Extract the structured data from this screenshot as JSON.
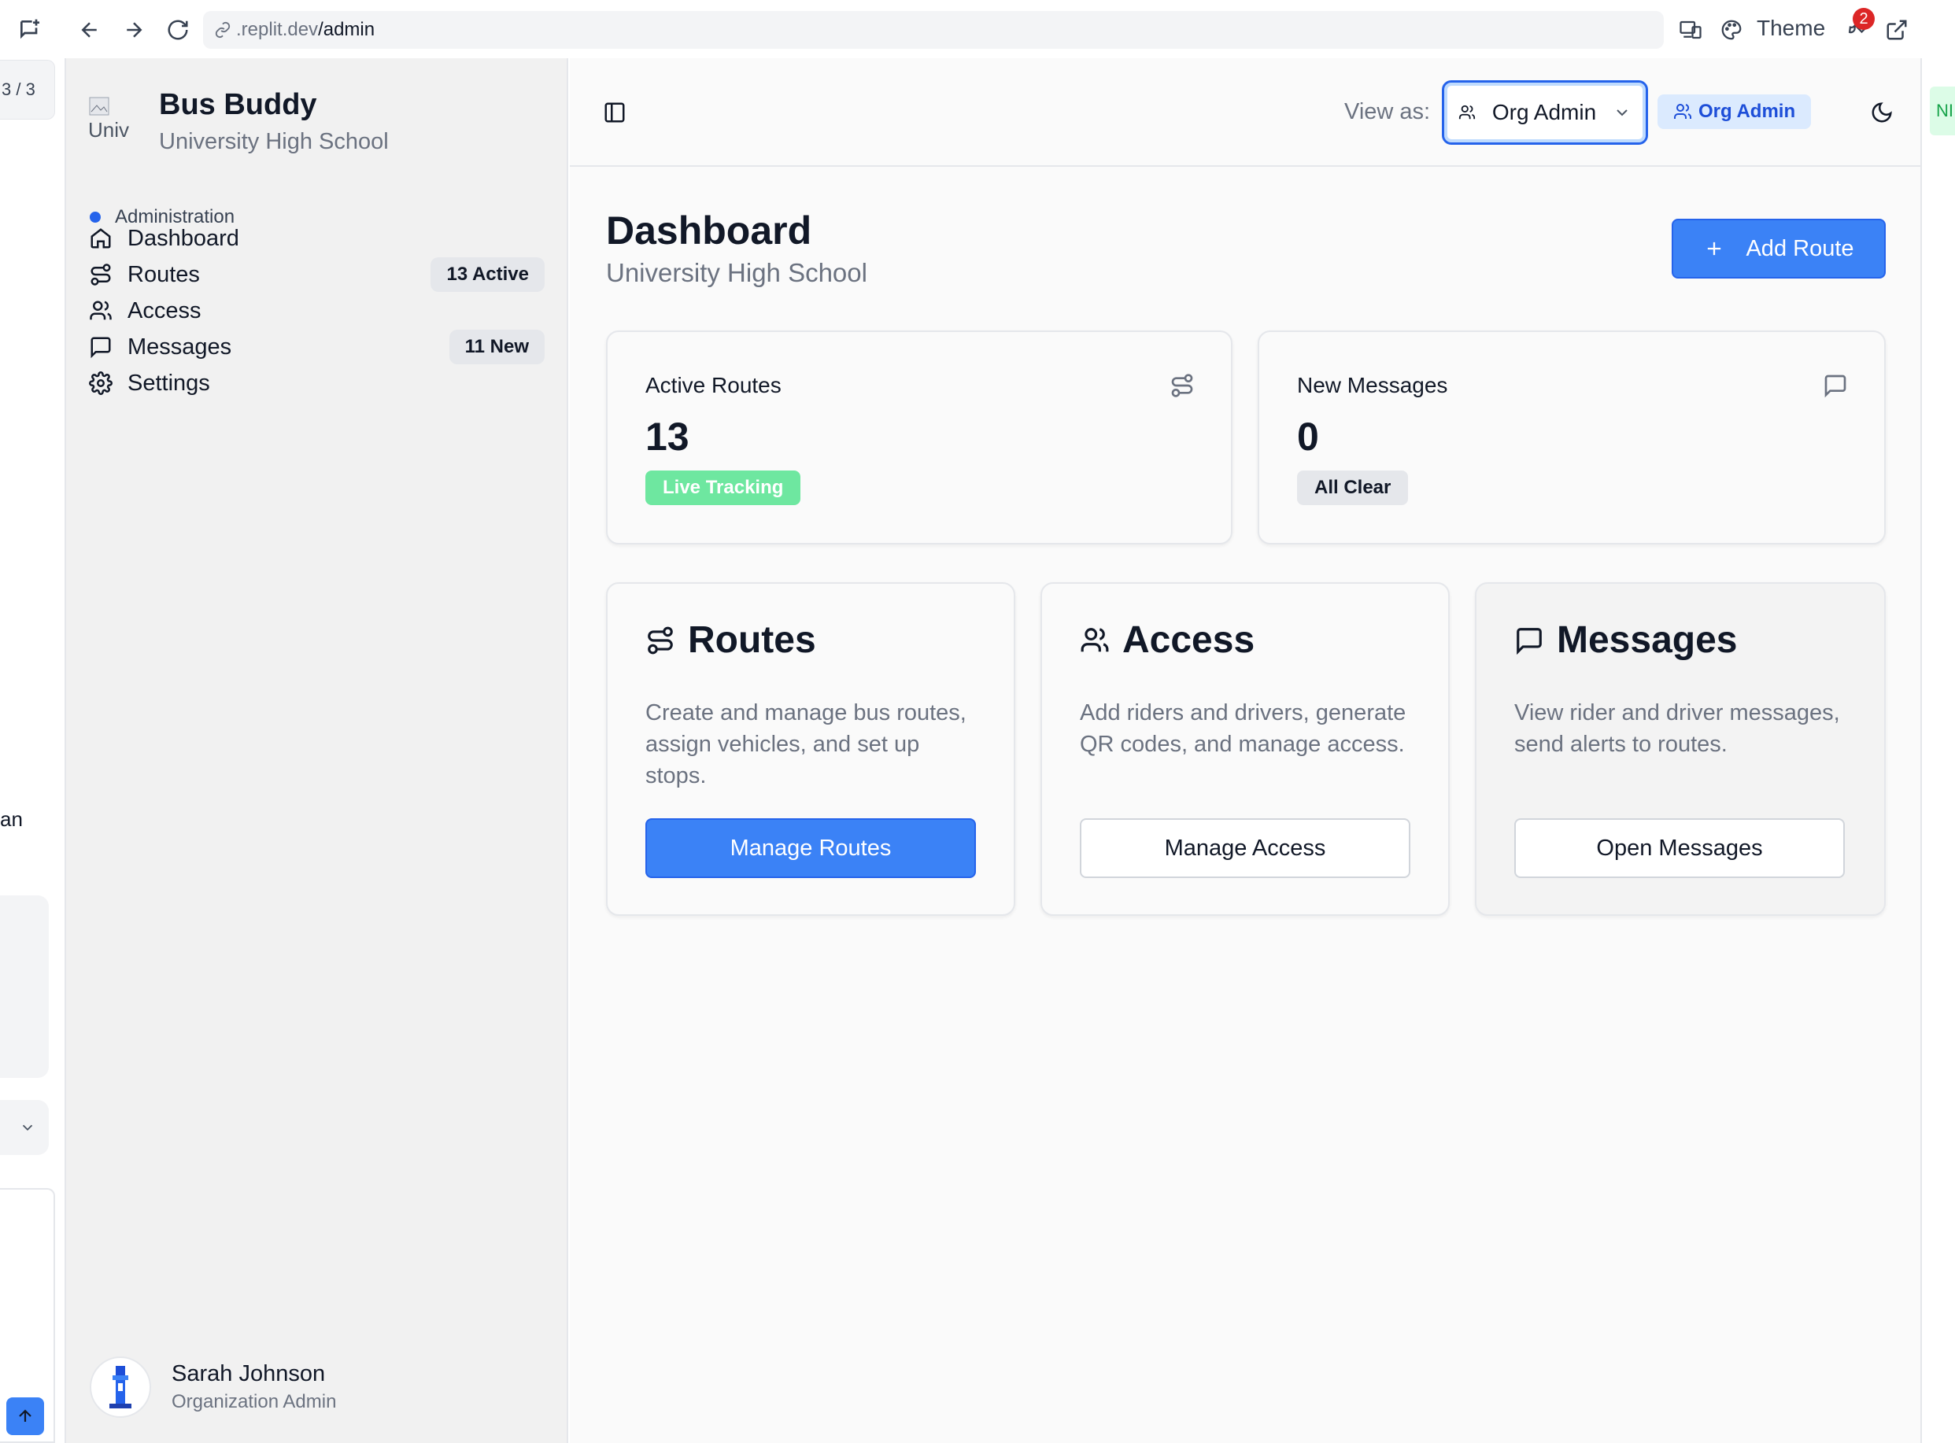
{
  "browser": {
    "url_prefix": ".replit.dev",
    "url_path": "/admin",
    "theme_label": "Theme",
    "notification_count": "2"
  },
  "left_pane": {
    "page_counter": "3 / 3",
    "fragment_text": "an"
  },
  "right_pane": {
    "fragment_text": "NI"
  },
  "sidebar": {
    "logo_alt": "Univ",
    "app_name": "Bus Buddy",
    "school_name": "University High School",
    "group_label": "Administration",
    "items": [
      {
        "label": "Dashboard",
        "icon": "home-icon",
        "badge": ""
      },
      {
        "label": "Routes",
        "icon": "route-icon",
        "badge": "13 Active"
      },
      {
        "label": "Access",
        "icon": "users-icon",
        "badge": ""
      },
      {
        "label": "Messages",
        "icon": "message-icon",
        "badge": "11 New"
      },
      {
        "label": "Settings",
        "icon": "gear-icon",
        "badge": ""
      }
    ],
    "user": {
      "name": "Sarah Johnson",
      "role": "Organization Admin"
    }
  },
  "header": {
    "view_as_label": "View as:",
    "view_as_value": "Org Admin",
    "role_pill": "Org Admin"
  },
  "main": {
    "title": "Dashboard",
    "subtitle": "University High School",
    "add_button": "Add Route",
    "stats": [
      {
        "label": "Active Routes",
        "value": "13",
        "pill": "Live Tracking",
        "icon": "route-icon"
      },
      {
        "label": "New Messages",
        "value": "0",
        "pill": "All Clear",
        "icon": "message-icon"
      }
    ],
    "features": [
      {
        "title": "Routes",
        "icon": "route-icon",
        "description": "Create and manage bus routes, assign vehicles, and set up stops.",
        "button": "Manage Routes"
      },
      {
        "title": "Access",
        "icon": "users-icon",
        "description": "Add riders and drivers, generate QR codes, and manage access.",
        "button": "Manage Access"
      },
      {
        "title": "Messages",
        "icon": "message-icon",
        "description": "View rider and driver messages, send alerts to routes.",
        "button": "Open Messages"
      }
    ]
  },
  "colors": {
    "accent": "#3b82f6",
    "live_green": "#6ee7a0",
    "role_pill_bg": "#dbeafe",
    "notification_red": "#dc2626"
  }
}
